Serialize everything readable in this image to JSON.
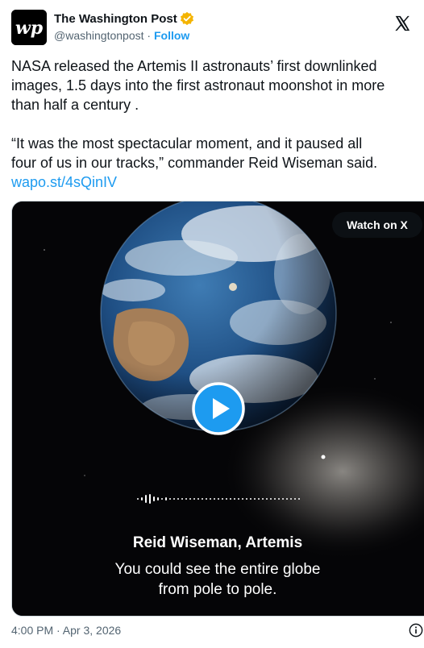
{
  "header": {
    "display_name": "The Washington Post",
    "handle": "@washingtonpost",
    "separator": " · ",
    "follow_label": "Follow",
    "avatar_icon": "wp-logo-icon",
    "verified_icon": "verified-badge-icon",
    "verified_color": "#f4b400",
    "platform_icon": "x-logo-icon"
  },
  "tweet": {
    "paragraph1_line1": "NASA released the Artemis II astronauts’ first downlinked",
    "paragraph1_line2": "images, 1.5 days into the first astronaut moonshot in more",
    "paragraph1_line3": "than half a century .",
    "paragraph2_line1": "“It was the most spectacular moment, and it paused all",
    "paragraph2_line2": "four of us in our tracks,” commander Reid Wiseman said.",
    "link": "wapo.st/4sQinIV"
  },
  "media": {
    "watch_label": "Watch on X",
    "play_icon": "play-icon",
    "audio_icon": "waveform-icon",
    "caption_speaker": "Reid Wiseman, Artemis",
    "caption_line1": "You could see the entire globe",
    "caption_line2": "from pole to pole."
  },
  "footer": {
    "timestamp": "4:00 PM · Apr 3, 2026",
    "info_icon": "info-icon"
  },
  "colors": {
    "accent": "#1d9bf0",
    "text": "#0f1419",
    "secondary": "#536471"
  }
}
